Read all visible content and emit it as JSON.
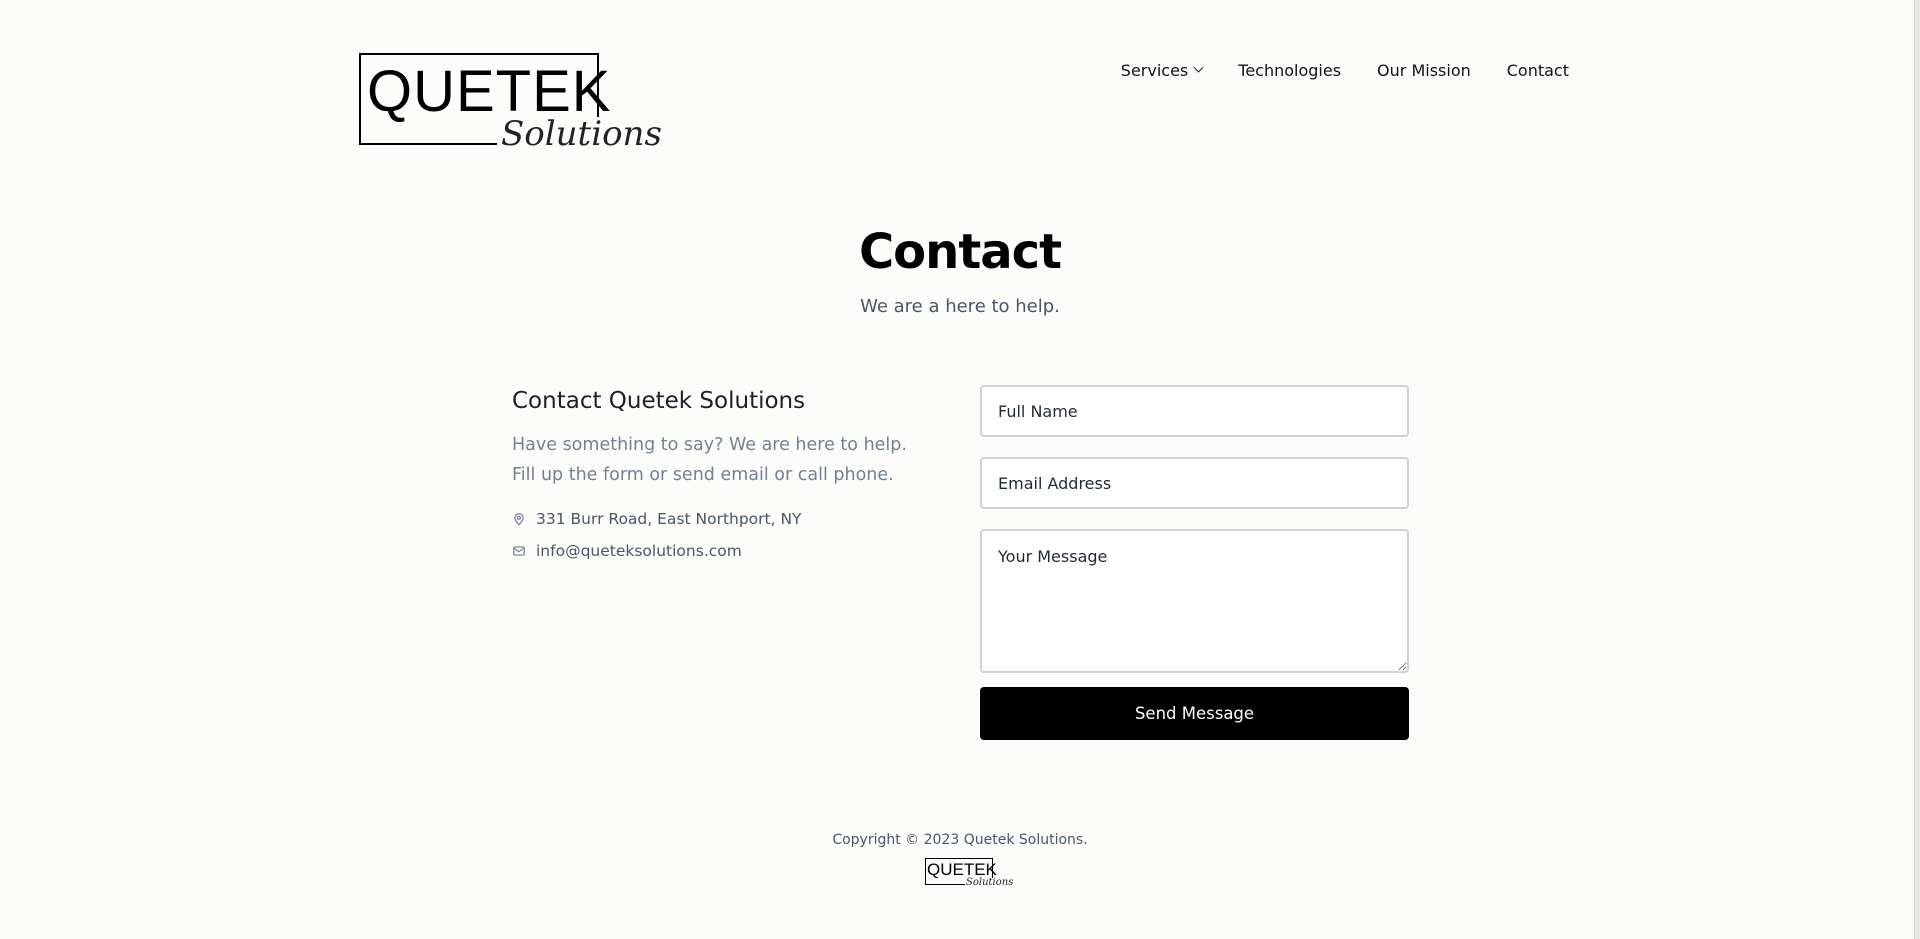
{
  "header": {
    "logo": {
      "main": "QUETEK",
      "script": "Solutions"
    },
    "nav": [
      {
        "label": "Services",
        "icon": "chevron-down-icon"
      },
      {
        "label": "Technologies"
      },
      {
        "label": "Our Mission"
      },
      {
        "label": "Contact"
      }
    ]
  },
  "hero": {
    "title": "Contact",
    "subtitle": "We are a here to help."
  },
  "contact_info": {
    "heading": "Contact Quetek Solutions",
    "description": "Have something to say? We are here to help. Fill up the form or send email or call phone.",
    "address": {
      "icon": "map-pin-icon",
      "text": "331 Burr Road, East Northport, NY"
    },
    "email": {
      "icon": "mail-icon",
      "text": "info@queteksolutions.com"
    }
  },
  "form": {
    "full_name": {
      "placeholder": "Full Name",
      "value": ""
    },
    "email": {
      "placeholder": "Email Address",
      "value": ""
    },
    "message": {
      "placeholder": "Your Message",
      "value": ""
    },
    "submit_label": "Send Message"
  },
  "footer": {
    "copyright": "Copyright © 2023 Quetek Solutions.",
    "logo": {
      "main": "QUETEK",
      "script": "Solutions"
    }
  },
  "colors": {
    "background": "#fcfdfb",
    "button": "#000000",
    "muted_text": "#718096"
  }
}
